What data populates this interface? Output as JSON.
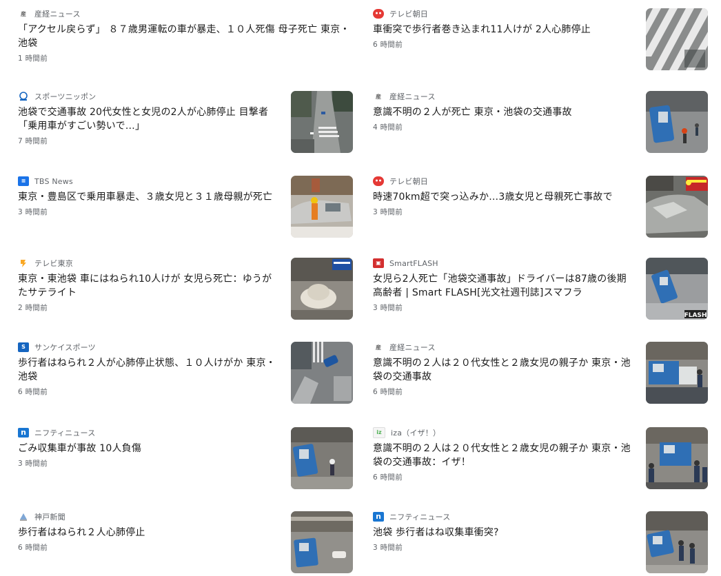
{
  "articles": [
    {
      "source": "産経ニュース",
      "icon": "sankei-logo-icon",
      "title": "「アクセル戻らず」 ８７歳男運転の車が暴走、１０人死傷 母子死亡 東京・池袋",
      "time": "1 時間前",
      "image": "none"
    },
    {
      "source": "テレビ朝日",
      "icon": "tv-asahi-logo-icon",
      "title": "車衝突で歩行者巻き込まれ11人けが 2人心肺停止",
      "time": "6 時間前",
      "image": "crosswalk-thumbnail"
    },
    {
      "source": "スポーツニッポン",
      "icon": "sponichi-logo-icon",
      "title": "池袋で交通事故 20代女性と女児の2人が心肺停止 目撃者「乗用車がすごい勢いで…」",
      "time": "7 時間前",
      "image": "aerial-street-thumbnail"
    },
    {
      "source": "産経ニュース",
      "icon": "sankei-logo-icon",
      "title": "意識不明の２人が死亡 東京・池袋の交通事故",
      "time": "4 時間前",
      "image": "overturned-truck-thumbnail"
    },
    {
      "source": "TBS News",
      "icon": "tbs-news-logo-icon",
      "title": "東京・豊島区で乗用車暴走、３歳女児と３１歳母親が死亡",
      "time": "3 時間前",
      "image": "crashed-car-thumbnail"
    },
    {
      "source": "テレビ朝日",
      "icon": "tv-asahi-logo-icon",
      "title": "時速70km超で突っ込みか…3歳女児と母親死亡事故で",
      "time": "3 時間前",
      "image": "damaged-car-thumbnail"
    },
    {
      "source": "テレビ東京",
      "icon": "tv-tokyo-logo-icon",
      "title": "東京・東池袋 車にはねられ10人けが 女児ら死亡：ゆうがたサテライト",
      "time": "2 時間前",
      "image": "helmet-debris-thumbnail"
    },
    {
      "source": "SmartFLASH",
      "icon": "smartflash-logo-icon",
      "title": "女児ら2人死亡「池袋交通事故」ドライバーは87歳の後期高齢者 | Smart FLASH[光文社週刊誌]スマフラ",
      "time": "3 時間前",
      "image": "flash-truck-thumbnail"
    },
    {
      "source": "サンケイスポーツ",
      "icon": "sankei-sports-logo-icon",
      "title": "歩行者はねられ２人が心肺停止状態、１０人けがか 東京・池袋",
      "time": "6 時間前",
      "image": "aerial-scene-thumbnail"
    },
    {
      "source": "産経ニュース",
      "icon": "sankei-logo-icon",
      "title": "意識不明の２人は２０代女性と２歳女児の親子か 東京・池袋の交通事故",
      "time": "6 時間前",
      "image": "truck-crowd-thumbnail"
    },
    {
      "source": "ニフティニュース",
      "icon": "nifty-logo-icon",
      "title": "ごみ収集車が事故 10人負傷",
      "time": "3 時間前",
      "image": "garbage-truck-thumbnail"
    },
    {
      "source": "iza（イザ！）",
      "icon": "iza-logo-icon",
      "title": "意識不明の２人は２０代女性と２歳女児の親子か 東京・池袋の交通事故：イザ！",
      "time": "6 時間前",
      "image": "police-truck-thumbnail"
    },
    {
      "source": "神戸新聞",
      "icon": "kobe-shimbun-logo-icon",
      "title": "歩行者はねられ２人心肺停止",
      "time": "6 時間前",
      "image": "overpass-truck-thumbnail"
    },
    {
      "source": "ニフティニュース",
      "icon": "nifty-logo-icon",
      "title": "池袋 歩行者はね収集車衝突?",
      "time": "3 時間前",
      "image": "street-police-thumbnail"
    }
  ],
  "icon_labels": {
    "tbs": "≡",
    "nifty": "n",
    "smartflash": "▣",
    "sankeisports": "S",
    "iza": "iz"
  },
  "colors": {
    "source_text": "#5f6368",
    "headline_text": "#1a1a1a",
    "tv_asahi_red": "#e53935",
    "nifty_blue": "#1976d2",
    "tbs_blue": "#1a73e8"
  }
}
